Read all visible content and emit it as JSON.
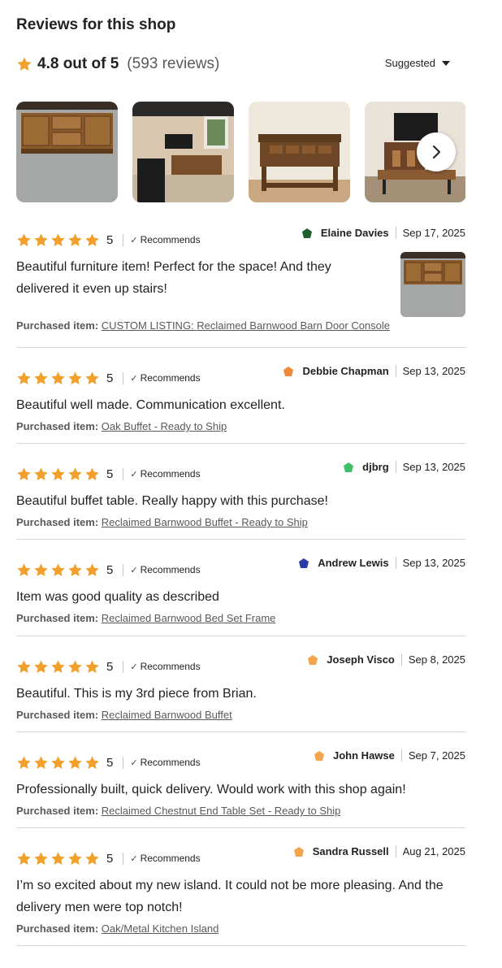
{
  "header": {
    "title": "Reviews for this shop",
    "rating": "4.8 out of 5",
    "count": "(593 reviews)",
    "sort_label": "Suggested"
  },
  "colors": {
    "star": "#F1A02B",
    "text": "#222222",
    "muted": "#595959",
    "divider": "#D6D6D6"
  },
  "photos": [
    "console-photo",
    "living-room-photo",
    "table-photo",
    "tv-stand-photo"
  ],
  "reviews": [
    {
      "stars": "5",
      "recommends": "Recommends",
      "name": "Elaine Davies",
      "date": "Sep 17, 2025",
      "text": "Beautiful furniture item! Perfect for the space! And they delivered it even up stairs!",
      "purchased_label": "Purchased item:",
      "item": "CUSTOM LISTING: Reclaimed Barnwood Barn Door Console",
      "avatar_color": "#1f5e2e"
    },
    {
      "stars": "5",
      "recommends": "Recommends",
      "name": "Debbie Chapman",
      "date": "Sep 13, 2025",
      "text": "Beautiful well made. Communication excellent.",
      "purchased_label": "Purchased item:",
      "item": "Oak Buffet - Ready to Ship",
      "avatar_color": "#f08a3a"
    },
    {
      "stars": "5",
      "recommends": "Recommends",
      "name": "djbrg",
      "date": "Sep 13, 2025",
      "text": "Beautiful buffet table. Really happy with this purchase!",
      "purchased_label": "Purchased item:",
      "item": "Reclaimed Barnwood Buffet - Ready to Ship",
      "avatar_color": "#3fbf6a"
    },
    {
      "stars": "5",
      "recommends": "Recommends",
      "name": "Andrew Lewis",
      "date": "Sep 13, 2025",
      "text": "Item was good quality as described",
      "purchased_label": "Purchased item:",
      "item": "Reclaimed Barnwood Bed Set Frame",
      "avatar_color": "#2b3aa8"
    },
    {
      "stars": "5",
      "recommends": "Recommends",
      "name": "Joseph Visco",
      "date": "Sep 8, 2025",
      "text": "Beautiful. This is my 3rd piece from Brian.",
      "purchased_label": "Purchased item:",
      "item": "Reclaimed Barnwood Buffet",
      "avatar_color": "#f2a54a"
    },
    {
      "stars": "5",
      "recommends": "Recommends",
      "name": "John Hawse",
      "date": "Sep 7, 2025",
      "text": "Professionally built, quick delivery. Would work with this shop again!",
      "purchased_label": "Purchased item:",
      "item": "Reclaimed Chestnut End Table Set - Ready to Ship",
      "avatar_color": "#f2a54a"
    },
    {
      "stars": "5",
      "recommends": "Recommends",
      "name": "Sandra Russell",
      "date": "Aug 21, 2025",
      "text": "I’m so excited about my new island. It could not be more pleasing. And the delivery men were top notch!",
      "purchased_label": "Purchased item:",
      "item": "Oak/Metal Kitchen Island",
      "avatar_color": "#f2a54a"
    }
  ]
}
